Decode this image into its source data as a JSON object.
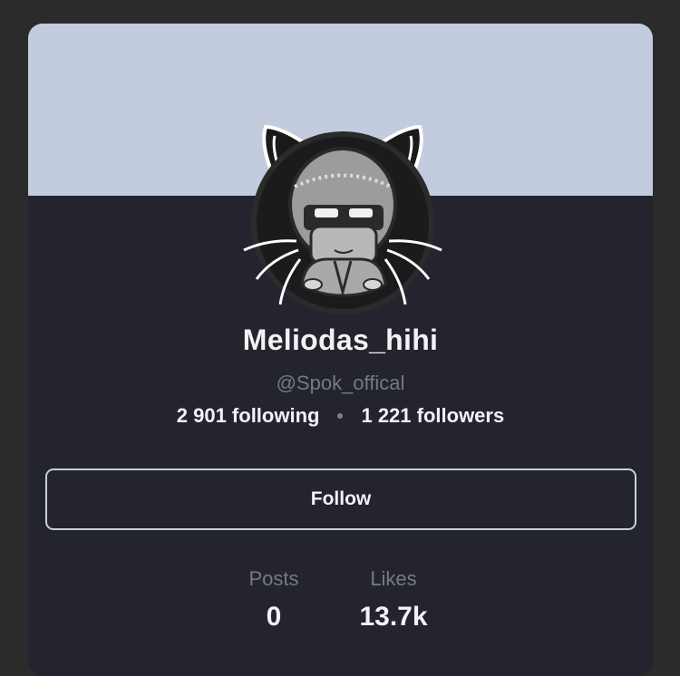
{
  "profile": {
    "username": "Meliodas_hihi",
    "handle": "@Spok_offical",
    "following": "2 901 following",
    "followers": "1 221 followers",
    "avatar_icon": "cat-ninja-avatar-icon"
  },
  "actions": {
    "follow_label": "Follow"
  },
  "metrics": {
    "posts_label": "Posts",
    "posts_value": "0",
    "likes_label": "Likes",
    "likes_value": "13.7k"
  },
  "colors": {
    "banner": "#c3cbde",
    "card": "#23242e",
    "page_background": "#2b2b2c",
    "text_primary": "#f2f2f4",
    "text_muted": "#767985"
  }
}
